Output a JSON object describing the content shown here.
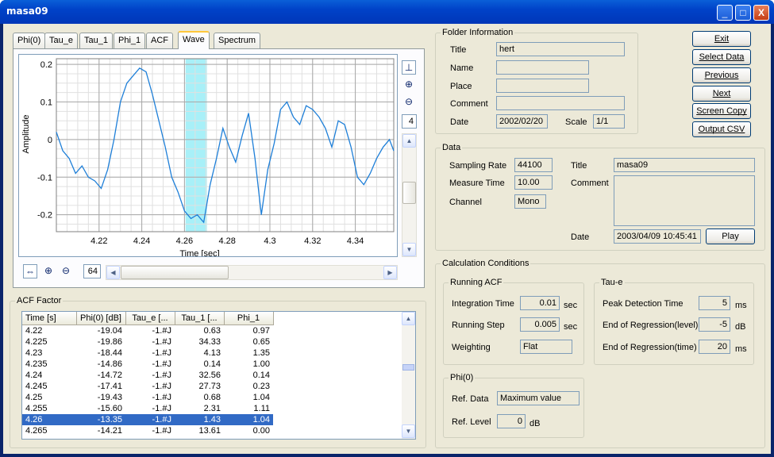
{
  "window": {
    "title": "masa09",
    "controls": [
      "_",
      "□",
      "X"
    ]
  },
  "tabs": [
    "Phi(0)",
    "Tau_e",
    "Tau_1",
    "Phi_1",
    "ACF",
    "Wave",
    "Spectrum"
  ],
  "active_tab": "Wave",
  "chart_data": {
    "type": "line",
    "xlabel": "Time [sec]",
    "ylabel": "Amplitude",
    "xlim": [
      4.2,
      4.358
    ],
    "ylim": [
      -0.245,
      0.215
    ],
    "xticks": [
      "4.22",
      "4.24",
      "4.26",
      "4.28",
      "4.3",
      "4.32",
      "4.34"
    ],
    "yticks": [
      "0.2",
      "0.1",
      "0",
      "-0.1",
      "-0.2"
    ],
    "highlight": [
      4.2605,
      4.2705
    ],
    "grid": true,
    "color": "#1e7fd8",
    "highlight_color": "#a8f0f8",
    "series": [
      {
        "x": [
          4.2,
          4.203,
          4.206,
          4.209,
          4.212,
          4.215,
          4.218,
          4.221,
          4.224,
          4.227,
          4.23,
          4.233,
          4.236,
          4.239,
          4.242,
          4.245,
          4.248,
          4.251,
          4.254,
          4.257,
          4.26,
          4.263,
          4.266,
          4.269,
          4.272,
          4.275,
          4.278,
          4.281,
          4.284,
          4.287,
          4.29,
          4.293,
          4.296,
          4.299,
          4.302,
          4.305,
          4.308,
          4.311,
          4.314,
          4.317,
          4.32,
          4.323,
          4.326,
          4.329,
          4.332,
          4.335,
          4.338,
          4.341,
          4.344,
          4.347,
          4.35,
          4.353,
          4.356,
          4.358
        ],
        "y": [
          0.02,
          -0.03,
          -0.05,
          -0.09,
          -0.07,
          -0.1,
          -0.11,
          -0.13,
          -0.08,
          0.0,
          0.1,
          0.15,
          0.17,
          0.19,
          0.18,
          0.12,
          0.05,
          -0.02,
          -0.1,
          -0.14,
          -0.19,
          -0.21,
          -0.2,
          -0.22,
          -0.12,
          -0.05,
          0.03,
          -0.02,
          -0.06,
          0.01,
          0.07,
          -0.05,
          -0.2,
          -0.08,
          -0.01,
          0.08,
          0.1,
          0.06,
          0.04,
          0.09,
          0.08,
          0.06,
          0.03,
          -0.02,
          0.05,
          0.04,
          -0.02,
          -0.1,
          -0.12,
          -0.09,
          -0.05,
          -0.02,
          0.0,
          -0.03
        ]
      }
    ]
  },
  "chart_tools": {
    "zoom_value": "4",
    "h_zoom_value": "64"
  },
  "acf": {
    "title": "ACF Factor",
    "columns": [
      "Time [s]",
      "Phi(0) [dB]",
      "Tau_e [...",
      "Tau_1 [...",
      "Phi_1"
    ],
    "rows": [
      [
        "4.22",
        "-19.04",
        "-1.#J",
        "0.63",
        "0.97"
      ],
      [
        "4.225",
        "-19.86",
        "-1.#J",
        "34.33",
        "0.65"
      ],
      [
        "4.23",
        "-18.44",
        "-1.#J",
        "4.13",
        "1.35"
      ],
      [
        "4.235",
        "-14.86",
        "-1.#J",
        "0.14",
        "1.00"
      ],
      [
        "4.24",
        "-14.72",
        "-1.#J",
        "32.56",
        "0.14"
      ],
      [
        "4.245",
        "-17.41",
        "-1.#J",
        "27.73",
        "0.23"
      ],
      [
        "4.25",
        "-19.43",
        "-1.#J",
        "0.68",
        "1.04"
      ],
      [
        "4.255",
        "-15.60",
        "-1.#J",
        "2.31",
        "1.11"
      ],
      [
        "4.26",
        "-13.35",
        "-1.#J",
        "1.43",
        "1.04"
      ],
      [
        "4.265",
        "-14.21",
        "-1.#J",
        "13.61",
        "0.00"
      ]
    ],
    "selected_index": 8
  },
  "folder": {
    "title": "Folder Information",
    "title_label": "Title",
    "title_value": "hert",
    "name_label": "Name",
    "name_value": "",
    "place_label": "Place",
    "place_value": "",
    "comment_label": "Comment",
    "comment_value": "",
    "date_label": "Date",
    "date_value": "2002/02/20",
    "scale_label": "Scale",
    "scale_value": "1/1"
  },
  "buttons": {
    "exit": "Exit",
    "select_data": "Select Data",
    "previous": "Previous",
    "next": "Next",
    "screen_copy": "Screen Copy",
    "output_csv": "Output CSV",
    "play": "Play"
  },
  "data": {
    "title": "Data",
    "sampling_rate_label": "Sampling Rate",
    "sampling_rate_value": "44100",
    "measure_time_label": "Measure Time",
    "measure_time_value": "10.00",
    "channel_label": "Channel",
    "channel_value": "Mono",
    "title_label": "Title",
    "title_value": "masa09",
    "comment_label": "Comment",
    "comment_value": "",
    "date_label": "Date",
    "date_value": "2003/04/09 10:45:41"
  },
  "calc": {
    "title": "Calculation Conditions",
    "running_acf": {
      "title": "Running ACF",
      "integration_time_label": "Integration Time",
      "integration_time_value": "0.01",
      "integration_time_unit": "sec",
      "running_step_label": "Running Step",
      "running_step_value": "0.005",
      "running_step_unit": "sec",
      "weighting_label": "Weighting",
      "weighting_value": "Flat"
    },
    "tau_e": {
      "title": "Tau-e",
      "peak_label": "Peak Detection Time",
      "peak_value": "5",
      "peak_unit": "ms",
      "eor_level_label": "End of Regression(level)",
      "eor_level_value": "-5",
      "eor_level_unit": "dB",
      "eor_time_label": "End of Regression(time)",
      "eor_time_value": "20",
      "eor_time_unit": "ms"
    },
    "phi0": {
      "title": "Phi(0)",
      "ref_data_label": "Ref. Data",
      "ref_data_value": "Maximum value",
      "ref_level_label": "Ref. Level",
      "ref_level_value": "0",
      "ref_level_unit": "dB"
    }
  }
}
